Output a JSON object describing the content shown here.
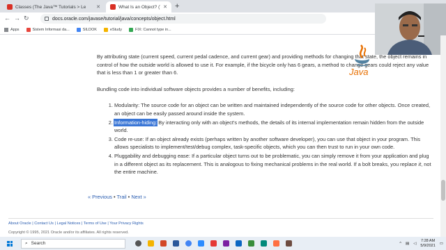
{
  "browser": {
    "tabs": [
      {
        "title": "Classes (The Java™ Tutorials > Le",
        "active": false,
        "favicon_color": "#d93025"
      },
      {
        "title": "What Is an Object? (The Java™ T",
        "active": true,
        "favicon_color": "#d93025"
      }
    ],
    "url": "docs.oracle.com/javase/tutorial/java/concepts/object.html",
    "bookmarks": [
      {
        "label": "Apps",
        "icon": "apps-grid-icon",
        "color": "#5f6368"
      },
      {
        "label": "Sistem Informasi da...",
        "icon": "bookmark-favicon",
        "color": "#e8453c"
      },
      {
        "label": "SILDOK",
        "icon": "bookmark-favicon",
        "color": "#4285f4"
      },
      {
        "label": "eStudy",
        "icon": "bookmark-favicon",
        "color": "#f4b400"
      },
      {
        "label": "FIX: Cannot type in...",
        "icon": "bookmark-favicon",
        "color": "#34a853"
      }
    ]
  },
  "page": {
    "para1": "By attributing state (current speed, current pedal cadence, and current gear) and providing methods for changing that state, the object remains in control of how the outside world is allowed to use it. For example, if the bicycle only has 6 gears, a method to change gears could reject any value that is less than 1 or greater than 6.",
    "para2": "Bundling code into individual software objects provides a number of benefits, including:",
    "benefits": [
      {
        "lead": "Modularity:",
        "text": " The source code for an object can be written and maintained independently of the source code for other objects. Once created, an object can be easily passed around inside the system."
      },
      {
        "lead": "Information-hiding:",
        "text": " By interacting only with an object's methods, the details of its internal implementation remain hidden from the outside world."
      },
      {
        "lead": "Code re-use:",
        "text": " If an object already exists (perhaps written by another software developer), you can use that object in your program. This allows specialists to implement/test/debug complex, task-specific objects, which you can then trust to run in your own code."
      },
      {
        "lead": "Pluggability and debugging ease:",
        "text": " If a particular object turns out to be problematic, you can simply remove it from your application and plug in a different object as its replacement. This is analogous to fixing mechanical problems in the real world. If a bolt breaks, you replace ",
        "em": "it",
        "tail": ", not the entire machine."
      }
    ],
    "pager": {
      "prev": "« Previous",
      "trail": "Trail",
      "next": "Next »",
      "sep": "•"
    },
    "footer_links": [
      "About Oracle",
      "Contact Us",
      "Legal Notices",
      "Terms of Use",
      "Your Privacy Rights"
    ],
    "copyright": "Copyright © 1995, 2021 Oracle and/or its affiliates. All rights reserved."
  },
  "java_logo_text": "Java",
  "taskbar": {
    "search_placeholder": "Search",
    "time": "7:28 AM",
    "date": "5/9/2021"
  }
}
